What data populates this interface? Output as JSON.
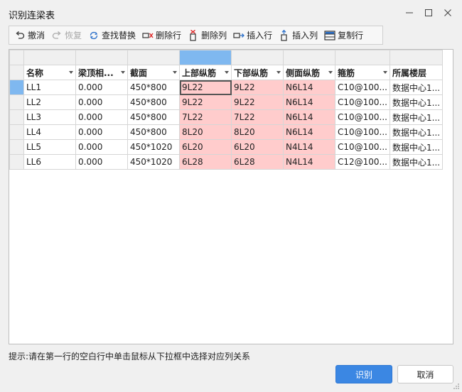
{
  "window": {
    "title": "识别连梁表"
  },
  "toolbar": {
    "items": [
      {
        "label": "撤消",
        "icon": "undo-icon",
        "enabled": true
      },
      {
        "label": "恢复",
        "icon": "redo-icon",
        "enabled": false
      },
      {
        "label": "查找替换",
        "icon": "find-replace-icon",
        "enabled": true
      },
      {
        "label": "删除行",
        "icon": "delete-row-icon",
        "enabled": true
      },
      {
        "label": "删除列",
        "icon": "delete-column-icon",
        "enabled": true
      },
      {
        "label": "插入行",
        "icon": "insert-row-icon",
        "enabled": true
      },
      {
        "label": "插入列",
        "icon": "insert-column-icon",
        "enabled": true
      },
      {
        "label": "复制行",
        "icon": "copy-row-icon",
        "enabled": true
      }
    ]
  },
  "table": {
    "columns": [
      "名称",
      "梁顶相...",
      "截面",
      "上部纵筋",
      "下部纵筋",
      "侧面纵筋",
      "箍筋",
      "所属楼层"
    ],
    "rows": [
      [
        "LL1",
        "0.000",
        "450*800",
        "9L22",
        "9L22",
        "N6L14",
        "C10@100...",
        "数据中心1..."
      ],
      [
        "LL2",
        "0.000",
        "450*800",
        "9L22",
        "9L22",
        "N6L14",
        "C10@100...",
        "数据中心1..."
      ],
      [
        "LL3",
        "0.000",
        "450*800",
        "7L22",
        "7L22",
        "N6L14",
        "C10@100...",
        "数据中心1..."
      ],
      [
        "LL4",
        "0.000",
        "450*800",
        "8L20",
        "8L20",
        "N6L14",
        "C10@100...",
        "数据中心1..."
      ],
      [
        "LL5",
        "0.000",
        "450*1020",
        "6L20",
        "6L20",
        "N4L14",
        "C10@100...",
        "数据中心1..."
      ],
      [
        "LL6",
        "0.000",
        "450*1020",
        "6L28",
        "6L28",
        "N4L14",
        "C12@100...",
        "数据中心1..."
      ]
    ]
  },
  "hint": "提示:请在第一行的空白行中单击鼠标从下拉框中选择对应列关系",
  "buttons": {
    "confirm": "识别",
    "cancel": "取消"
  },
  "colors": {
    "accent": "#3b87e3",
    "highlight": "#ffcccc",
    "selection": "#7fb8f0"
  }
}
